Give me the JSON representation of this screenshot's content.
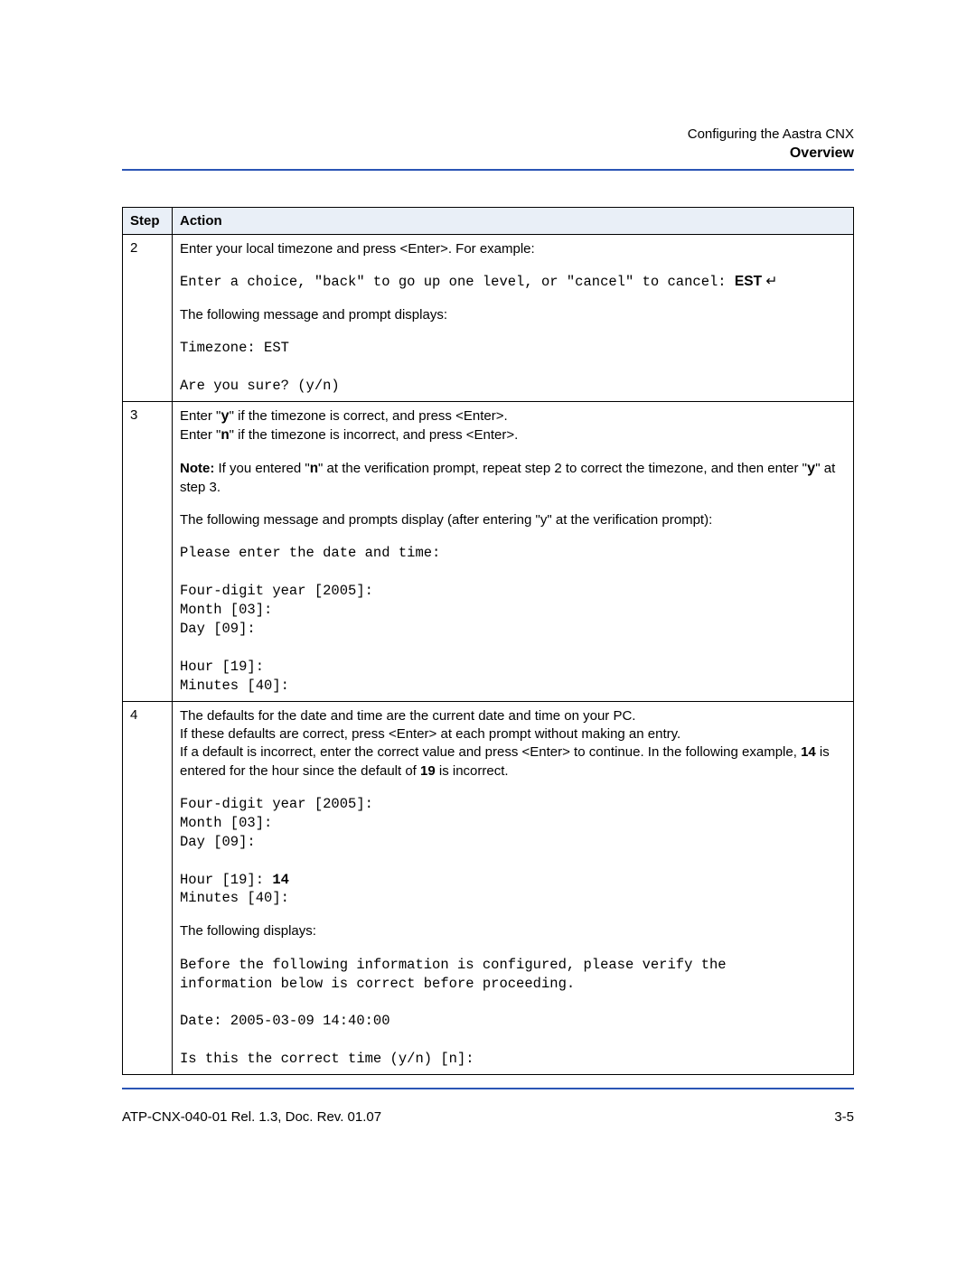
{
  "header": {
    "chapter": "Configuring the Aastra CNX",
    "section": "Overview"
  },
  "table": {
    "head_step": "Step",
    "head_action": "Action",
    "rows": [
      {
        "num": "2",
        "p1": "Enter your local timezone and press <Enter>. For example:",
        "code1_a": "Enter a choice, \"back\" to go up one level, or \"cancel\" to cancel: ",
        "code1_b": "EST",
        "code1_c": " ↵",
        "p2": "The following message and prompt displays:",
        "code2": "Timezone: EST\n\nAre you sure? (y/n)"
      },
      {
        "num": "3",
        "p1a": "Enter \"",
        "p1b": "y",
        "p1c": "\" if the timezone is correct, and press <Enter>.",
        "p2a": "Enter \"",
        "p2b": "n",
        "p2c": "\" if the timezone is incorrect, and press <Enter>.",
        "note_label": "Note:",
        "note_a": " If you entered \"",
        "note_b": "n",
        "note_c": "\" at the verification prompt, repeat step 2 to correct the timezone, and then enter \"",
        "note_d": "y",
        "note_e": "\" at step 3.",
        "p3": "The following message and prompts display (after entering \"y\" at the verification prompt):",
        "code1": "Please enter the date and time:\n\nFour-digit year [2005]:\nMonth [03]:\nDay [09]:\n\nHour [19]:\nMinutes [40]:"
      },
      {
        "num": "4",
        "p1": "The defaults for the date and time are the current date and time on your PC.",
        "p2": "If these defaults are correct, press <Enter> at each prompt without making an entry.",
        "p3a": "If a default is incorrect, enter the correct value and press <Enter> to continue. In the following example, ",
        "p3b": "14",
        "p3c": " is entered for the hour since the default of ",
        "p3d": "19",
        "p3e": " is incorrect.",
        "code1a": "Four-digit year [2005]:\nMonth [03]:\nDay [09]:\n\nHour [19]: ",
        "code1b": "14",
        "code1c": "\nMinutes [40]:",
        "p4": "The following displays:",
        "code2": "Before the following information is configured, please verify the\ninformation below is correct before proceeding.\n\nDate: 2005-03-09 14:40:00\n\nIs this the correct time (y/n) [n]:"
      }
    ]
  },
  "footer": {
    "left": "ATP-CNX-040-01 Rel. 1.3, Doc. Rev. 01.07",
    "right": "3-5"
  }
}
